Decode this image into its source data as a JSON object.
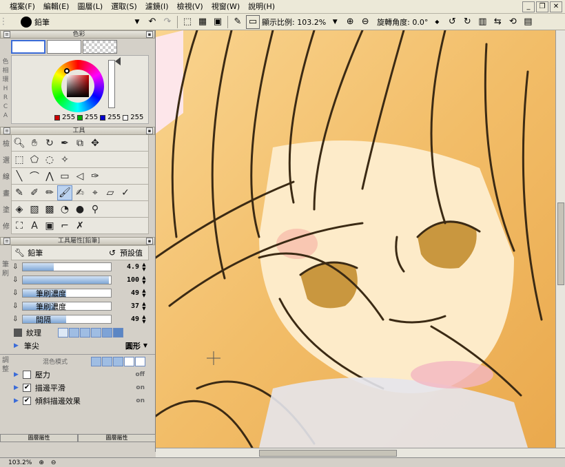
{
  "menu": {
    "items": [
      "檔案(F)",
      "編輯(E)",
      "圖層(L)",
      "選取(S)",
      "濾鏡(I)",
      "檢視(V)",
      "視窗(W)",
      "說明(H)"
    ]
  },
  "toolbar": {
    "brush_name": "鉛筆",
    "zoom_label": "顯示比例: 103.2%",
    "angle_label": "旋轉角度: 0.0°"
  },
  "color_panel": {
    "title": "色彩",
    "side_labels": [
      "色相",
      "環",
      "H",
      "R",
      "C",
      "A"
    ],
    "rgb": [
      {
        "channel": "R",
        "value": "255",
        "color": "#cc0000"
      },
      {
        "channel": "G",
        "value": "255",
        "color": "#00aa00"
      },
      {
        "channel": "B",
        "value": "255",
        "color": "#0000cc"
      },
      {
        "channel": "A",
        "value": "255",
        "color": "#ffffff"
      }
    ]
  },
  "tool_panel": {
    "title": "工具",
    "rows": [
      {
        "label": "檢",
        "icons": [
          "zoom-icon",
          "hand-icon",
          "rotate-icon",
          "eyedropper-icon",
          "layer-move-icon",
          "move-icon"
        ]
      },
      {
        "label": "選",
        "icons": [
          "rect-select-icon",
          "polygon-select-icon",
          "lasso-select-icon",
          "magic-wand-icon"
        ]
      },
      {
        "label": "線",
        "icons": [
          "line-icon",
          "curve-icon",
          "polyline-icon",
          "rect-icon",
          "ellipse-icon",
          "pen-icon"
        ]
      },
      {
        "label": "畫",
        "icons": [
          "pencil-icon",
          "pen-tool-icon",
          "marker-icon",
          "brush-icon",
          "watercolor-icon",
          "airbrush-icon",
          "eraser-icon",
          "blend-icon"
        ]
      },
      {
        "label": "塗",
        "icons": [
          "fill-icon",
          "gradient-icon",
          "pattern-icon",
          "smudge-icon",
          "magnifier-icon",
          "stamp-icon"
        ]
      },
      {
        "label": "修",
        "icons": [
          "clone-icon",
          "text-icon",
          "frame-icon",
          "ruler-icon",
          "vector-eraser-icon"
        ]
      }
    ]
  },
  "tool_props": {
    "title": "工具屬性[鉛筆]",
    "tool_name": "鉛筆",
    "reset_label": "預設值",
    "side_label": "筆刷",
    "rows": [
      {
        "label": "",
        "value": "4.9",
        "fill": 0.35
      },
      {
        "label": "",
        "value": "100",
        "fill": 0.98
      },
      {
        "label": "筆刷濃度",
        "value": "49",
        "fill": 0.49
      },
      {
        "label": "筆刷濃度",
        "value": "37",
        "fill": 0.37
      },
      {
        "label": "間隔",
        "value": "49",
        "fill": 0.49
      }
    ],
    "texture_label": "紋理",
    "tip_label": "筆尖",
    "tip_value": "圓形",
    "section_label": "調整",
    "blend_label": "混色模式",
    "checkboxes": [
      {
        "label": "壓力",
        "value": "off",
        "checked": false
      },
      {
        "label": "描邊平滑",
        "value": "on",
        "checked": true
      },
      {
        "label": "傾斜描邊效果",
        "value": "on",
        "checked": true
      }
    ]
  },
  "bottom_tabs": [
    "圖層屬性",
    "圖層屬性"
  ],
  "status": {
    "zoom": "103.2%"
  },
  "colors": {
    "hair_light": "#f7cf85",
    "hair_mid": "#efb35a",
    "skin": "#fce9c6",
    "accent": "#3a6bd8"
  }
}
